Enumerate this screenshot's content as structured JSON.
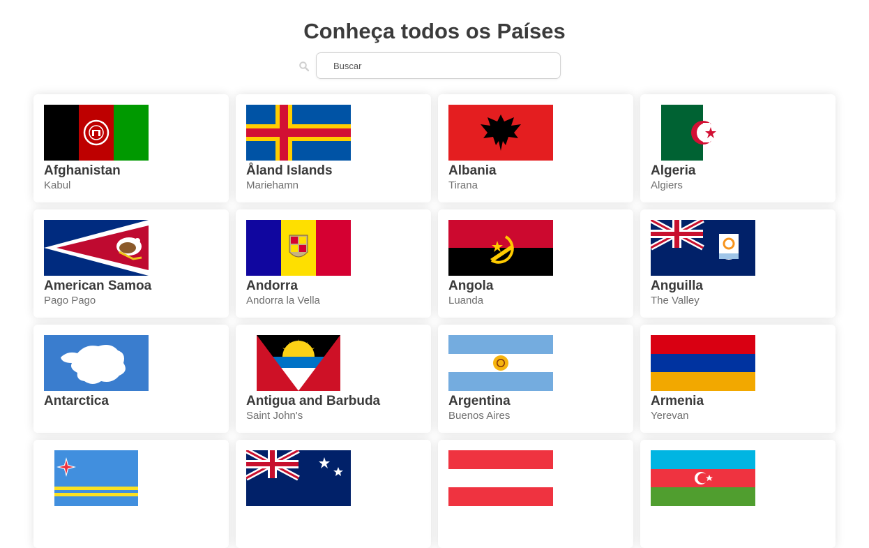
{
  "page": {
    "title": "Conheça todos os Países"
  },
  "search": {
    "placeholder": "Buscar",
    "value": "",
    "icon": "search-icon"
  },
  "countries": [
    {
      "name": "Afghanistan",
      "capital": "Kabul",
      "flag_icon": "afghanistan-flag-icon"
    },
    {
      "name": "Åland Islands",
      "capital": "Mariehamn",
      "flag_icon": "aland-islands-flag-icon"
    },
    {
      "name": "Albania",
      "capital": "Tirana",
      "flag_icon": "albania-flag-icon"
    },
    {
      "name": "Algeria",
      "capital": "Algiers",
      "flag_icon": "algeria-flag-icon"
    },
    {
      "name": "American Samoa",
      "capital": "Pago Pago",
      "flag_icon": "american-samoa-flag-icon"
    },
    {
      "name": "Andorra",
      "capital": "Andorra la Vella",
      "flag_icon": "andorra-flag-icon"
    },
    {
      "name": "Angola",
      "capital": "Luanda",
      "flag_icon": "angola-flag-icon"
    },
    {
      "name": "Anguilla",
      "capital": "The Valley",
      "flag_icon": "anguilla-flag-icon"
    },
    {
      "name": "Antarctica",
      "capital": "",
      "flag_icon": "antarctica-flag-icon"
    },
    {
      "name": "Antigua and Barbuda",
      "capital": "Saint John's",
      "flag_icon": "antigua-and-barbuda-flag-icon"
    },
    {
      "name": "Argentina",
      "capital": "Buenos Aires",
      "flag_icon": "argentina-flag-icon"
    },
    {
      "name": "Armenia",
      "capital": "Yerevan",
      "flag_icon": "armenia-flag-icon"
    },
    {
      "name": "",
      "capital": "",
      "flag_icon": "aruba-flag-icon"
    },
    {
      "name": "",
      "capital": "",
      "flag_icon": "australia-flag-icon"
    },
    {
      "name": "",
      "capital": "",
      "flag_icon": "austria-flag-icon"
    },
    {
      "name": "",
      "capital": "",
      "flag_icon": "azerbaijan-flag-icon"
    }
  ],
  "colors": {
    "card_background": "#ffffff",
    "title": "#3b3b3b",
    "country_name": "#3a3a3a",
    "capital": "#6f6f6f"
  }
}
